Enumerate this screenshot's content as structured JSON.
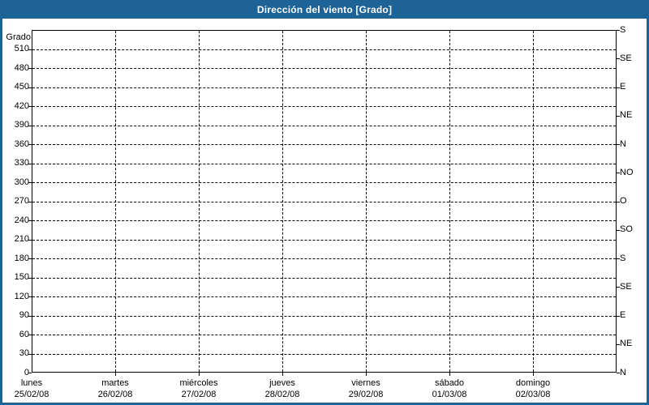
{
  "window": {
    "title": "Dirección del viento [Grado]",
    "colors": {
      "frame_blue": "#1d6396",
      "title_text": "#ffffff",
      "plot_background": "#ffffff",
      "grid_and_text": "#000000"
    }
  },
  "chart_data": {
    "type": "line",
    "title": "Dirección del viento [Grado]",
    "ylabel": "Grado",
    "ylim": [
      0,
      540
    ],
    "y_axis_left": {
      "caption": "Grado",
      "tick_step": 30,
      "ticks": [
        0,
        30,
        60,
        90,
        120,
        150,
        180,
        210,
        240,
        270,
        300,
        330,
        360,
        390,
        420,
        450,
        480,
        510
      ]
    },
    "y_axis_right": {
      "tick_step_degrees": 45,
      "labels_bottom_to_top": [
        "N",
        "NE",
        "E",
        "SE",
        "S",
        "SO",
        "O",
        "NO",
        "N",
        "NE",
        "E",
        "SE",
        "S"
      ]
    },
    "x_axis": {
      "days": [
        {
          "name": "lunes",
          "date": "25/02/08"
        },
        {
          "name": "martes",
          "date": "26/02/08"
        },
        {
          "name": "miércoles",
          "date": "27/02/08"
        },
        {
          "name": "jueves",
          "date": "28/02/08"
        },
        {
          "name": "viernes",
          "date": "29/02/08"
        },
        {
          "name": "sábado",
          "date": "01/03/08"
        },
        {
          "name": "domingo",
          "date": "02/03/08"
        }
      ]
    },
    "grid": {
      "style": "dashed",
      "horizontal_every_deg": 30,
      "vertical": "one-per-day"
    },
    "legend": "none",
    "series": []
  }
}
